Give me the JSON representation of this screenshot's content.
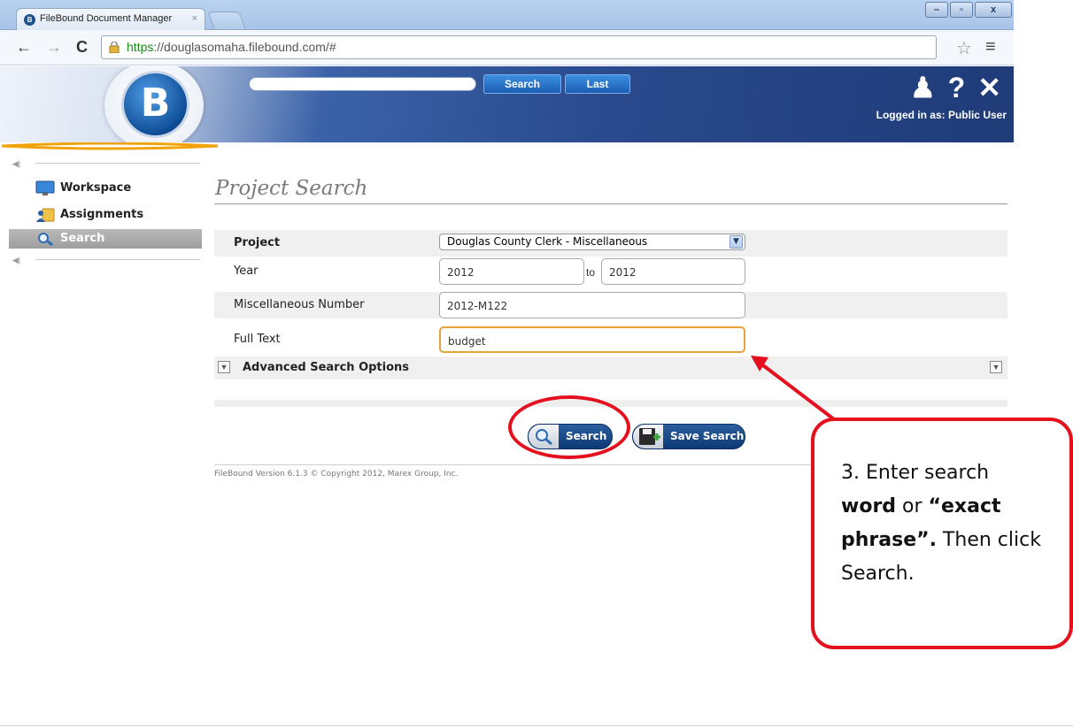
{
  "browser": {
    "tab_title": "FileBound Document Manager",
    "tab_close": "×",
    "url_scheme": "https",
    "url_rest": "://douglasomaha.filebound.com/#",
    "back_icon": "←",
    "forward_icon": "→",
    "reload_icon": "C",
    "star_icon": "☆",
    "menu_icon": "≡",
    "win_minimize": "–",
    "win_restore": "▫",
    "win_close": "x"
  },
  "header": {
    "search_label": "Search",
    "last_label": "Last",
    "logo_letter": "B",
    "user_icon": "♟",
    "help_icon": "?",
    "close_icon": "✕",
    "logged_in": "Logged in as: Public User"
  },
  "sidebar": {
    "items": [
      {
        "label": "Workspace"
      },
      {
        "label": "Assignments"
      },
      {
        "label": "Search"
      }
    ]
  },
  "main": {
    "title": "Project Search",
    "fields": {
      "project_label": "Project",
      "project_value": "Douglas County Clerk - Miscellaneous",
      "year_label": "Year",
      "year_from": "2012",
      "year_to_label": "to",
      "year_to": "2012",
      "misc_label": "Miscellaneous Number",
      "misc_value": "2012-M122",
      "fulltext_label": "Full Text",
      "fulltext_value": "budget",
      "advanced_label": "Advanced Search Options"
    },
    "search_button": "Search",
    "save_search_button": "Save Search",
    "footer": "FileBound Version 6.1.3 © Copyright 2012, Marex Group, Inc."
  },
  "annotation": {
    "line1": "3. Enter search",
    "word": "word",
    "or": " or ",
    "exact": "“exact",
    "phrase": "phrase”.",
    "then": " Then click",
    "search_end": "Search.",
    "accent_color": "#e4101e"
  }
}
